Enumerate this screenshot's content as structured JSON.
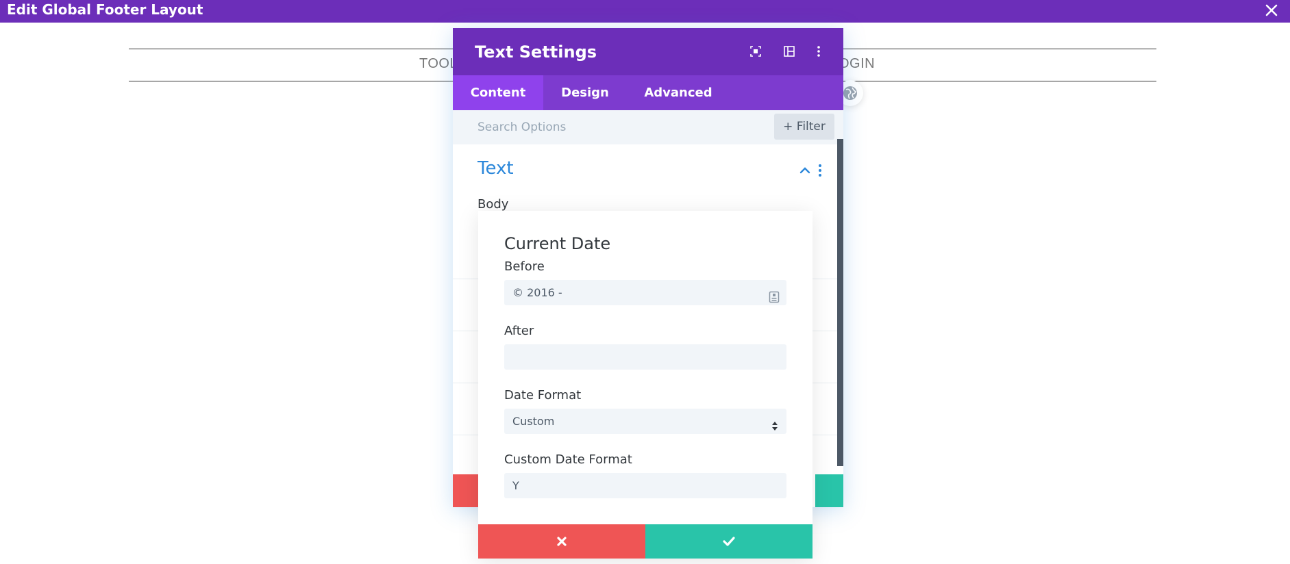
{
  "window": {
    "title": "Edit Global Footer Layout",
    "close_icon": "close-icon"
  },
  "canvas": {
    "nav_left": "TOOLS",
    "nav_right": "OGIN",
    "globe_icon": "globe-icon"
  },
  "panel": {
    "title": "Text Settings",
    "header_icons": [
      "focus-icon",
      "sidebar-layout-icon",
      "more-vertical-icon"
    ],
    "tabs": [
      {
        "label": "Content",
        "active": true
      },
      {
        "label": "Design",
        "active": false
      },
      {
        "label": "Advanced",
        "active": false
      }
    ],
    "search_placeholder": "Search Options",
    "filter_label": "+ Filter",
    "section_title": "Text",
    "body_label": "Body"
  },
  "dynamic_modal": {
    "title": "Current Date",
    "before_label": "Before",
    "before_value": "© 2016 -",
    "after_label": "After",
    "after_value": "",
    "date_format_label": "Date Format",
    "date_format_value": "Custom",
    "custom_format_label": "Custom Date Format",
    "custom_format_value": "Y"
  },
  "colors": {
    "brand_purple": "#6c2eb9",
    "tab_active": "#8f42ec",
    "section_blue": "#2b87da",
    "cancel_red": "#ef5555",
    "save_green": "#29c4a9"
  }
}
